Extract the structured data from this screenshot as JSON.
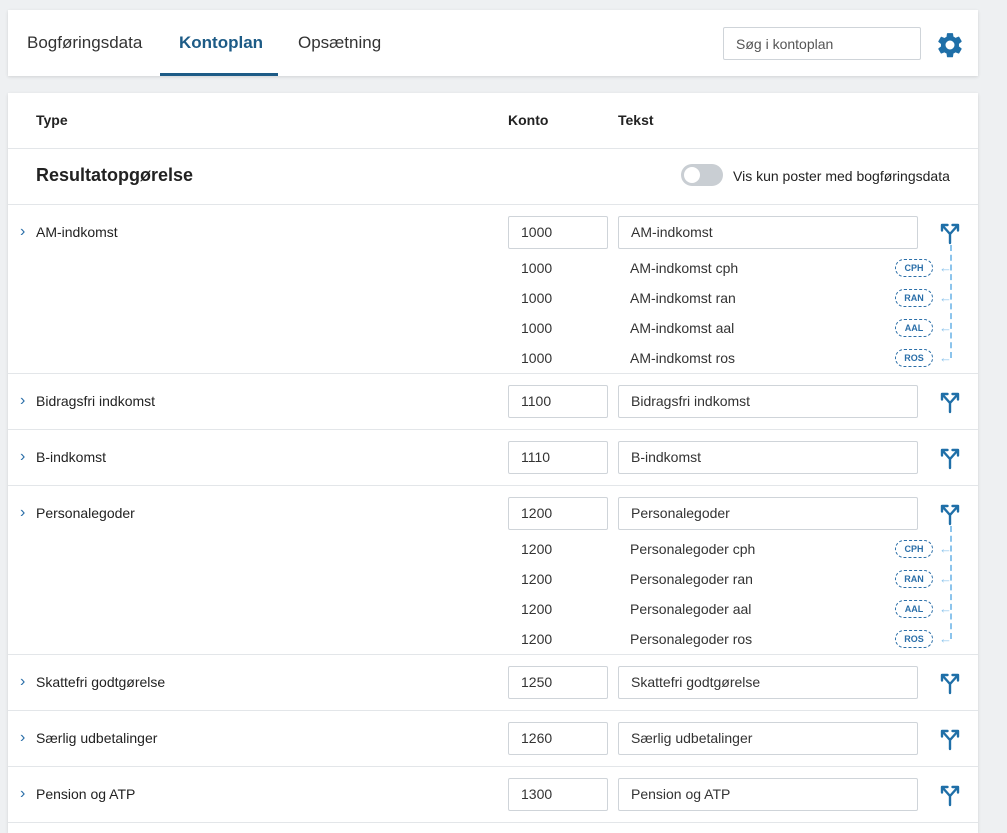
{
  "tabs": [
    {
      "label": "Bogføringsdata",
      "active": false
    },
    {
      "label": "Kontoplan",
      "active": true
    },
    {
      "label": "Opsætning",
      "active": false
    }
  ],
  "search": {
    "placeholder": "Søg i kontoplan"
  },
  "table": {
    "headers": {
      "type": "Type",
      "konto": "Konto",
      "tekst": "Tekst"
    },
    "section_title": "Resultatopgørelse",
    "toggle_label": "Vis kun poster med bogføringsdata",
    "toggle_on": false,
    "rows": [
      {
        "type": "AM-indkomst",
        "konto": "1000",
        "tekst": "AM-indkomst",
        "children": [
          {
            "konto": "1000",
            "tekst": "AM-indkomst cph",
            "badge": "CPH"
          },
          {
            "konto": "1000",
            "tekst": "AM-indkomst ran",
            "badge": "RAN"
          },
          {
            "konto": "1000",
            "tekst": "AM-indkomst aal",
            "badge": "AAL"
          },
          {
            "konto": "1000",
            "tekst": "AM-indkomst ros",
            "badge": "ROS"
          }
        ]
      },
      {
        "type": "Bidragsfri indkomst",
        "konto": "1100",
        "tekst": "Bidragsfri indkomst",
        "children": []
      },
      {
        "type": "B-indkomst",
        "konto": "1110",
        "tekst": "B-indkomst",
        "children": []
      },
      {
        "type": "Personalegoder",
        "konto": "1200",
        "tekst": "Personalegoder",
        "children": [
          {
            "konto": "1200",
            "tekst": "Personalegoder cph",
            "badge": "CPH"
          },
          {
            "konto": "1200",
            "tekst": "Personalegoder ran",
            "badge": "RAN"
          },
          {
            "konto": "1200",
            "tekst": "Personalegoder aal",
            "badge": "AAL"
          },
          {
            "konto": "1200",
            "tekst": "Personalegoder ros",
            "badge": "ROS"
          }
        ]
      },
      {
        "type": "Skattefri godtgørelse",
        "konto": "1250",
        "tekst": "Skattefri godtgørelse",
        "children": []
      },
      {
        "type": "Særlig udbetalinger",
        "konto": "1260",
        "tekst": "Særlig udbetalinger",
        "children": []
      },
      {
        "type": "Pension og ATP",
        "konto": "1300",
        "tekst": "Pension og ATP",
        "children": []
      }
    ]
  },
  "icons": {
    "settings": "gear-icon",
    "split": "split-arrows-icon",
    "expand": "chevron-right-icon"
  },
  "colors": {
    "accent": "#1d5b86",
    "link": "#2a6ea8",
    "dashed_line": "#8cc4ec",
    "background": "#eef0f2"
  }
}
